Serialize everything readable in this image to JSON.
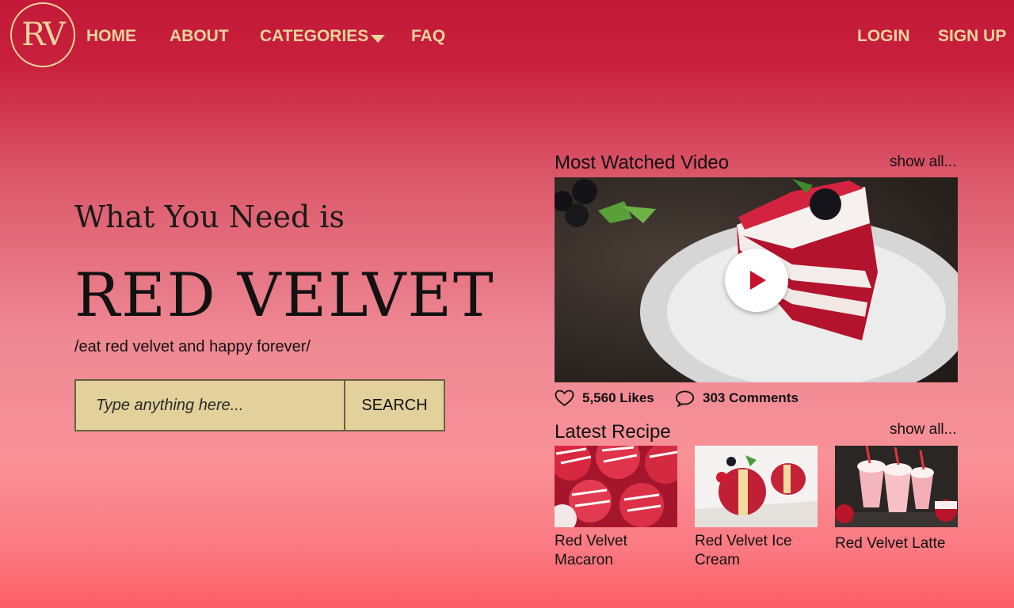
{
  "nav": {
    "logo_text": "RV",
    "home": "HOME",
    "about": "ABOUT",
    "categories": "CATEGORIES",
    "faq": "FAQ",
    "login": "LOGIN",
    "signup": "SIGN UP"
  },
  "hero": {
    "subtitle": "What You Need is",
    "title": "RED VELVET",
    "tagline": "/eat red velvet and happy forever/",
    "search_placeholder": "Type anything here...",
    "search_button": "SEARCH"
  },
  "video_section": {
    "title": "Most Watched Video",
    "show_all": "show all...",
    "likes": "5,560 Likes",
    "comments": "303 Comments"
  },
  "recipe_section": {
    "title": "Latest Recipe",
    "show_all": "show all...",
    "items": [
      {
        "name": "Red Velvet Macaron"
      },
      {
        "name": "Red Velvet Ice Cream"
      },
      {
        "name": "Red Velvet Latte"
      }
    ]
  },
  "colors": {
    "nav_text": "#ecd49c",
    "search_bg": "#e3d19b",
    "header_red": "#c21a38"
  },
  "icons": {
    "dropdown": "chevron-down-icon",
    "play": "play-icon",
    "likes": "heart-icon",
    "comments": "comment-icon"
  }
}
